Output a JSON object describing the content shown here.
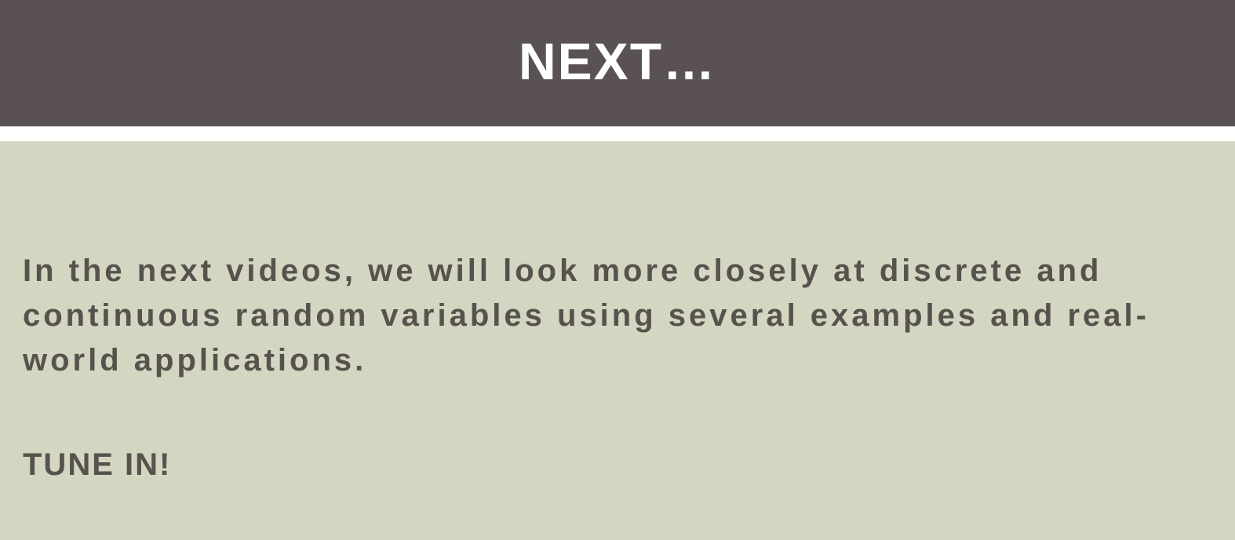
{
  "slide": {
    "title": "NEXT…",
    "body": "In the next videos, we will look more closely at discrete and continuous random variables using several examples and real-world applications.",
    "closing": "TUNE IN!"
  },
  "colors": {
    "title_bar_bg": "#5a5155",
    "title_text": "#ffffff",
    "content_bg": "#d3d6c1",
    "body_text": "#57524c"
  }
}
